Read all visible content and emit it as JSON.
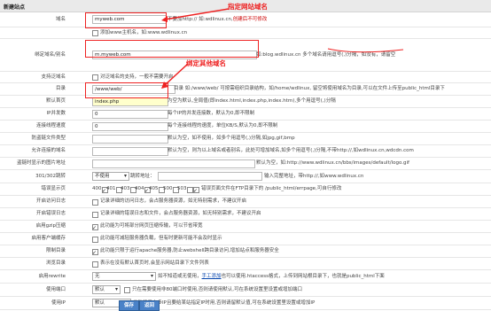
{
  "header": {
    "title": "新建站点"
  },
  "form": {
    "domain": {
      "label": "域名",
      "value": "myweb.com",
      "hint": "不要加http:// 如:wdlinux.cn,",
      "hint_red": "创建后不可修改"
    },
    "add_www": {
      "label": "添加www主机名，如:www.wdlinux.cn",
      "checked": false
    },
    "alias": {
      "label": "绑定域名/别名",
      "value": "m.myweb.com",
      "hint": "如:blog.wdlinux.cn 多个域名请用逗号(,)分隔，如没有，请留空"
    },
    "pan_domain": {
      "label": "支持泛域名",
      "text": "对泛域名的支持，一般不需要开启"
    },
    "dir": {
      "label": "目录",
      "value": "/www/web/",
      "hint": "目录 如:/www/web/ 可按需组织目录结构，如/home/wdlinux, 留空将使用域名为目录,可以在文件上传至public_html目录下"
    },
    "default_page": {
      "label": "默认首页",
      "value": "index.php",
      "hint": "为空为默认,全局值(即index.html,index.php,index.htm),多个用逗号(,)分隔"
    },
    "ip_conn": {
      "label": "IP并发数",
      "value": "0",
      "hint": "每个IP的并发连接数，默认为0,即不限制"
    },
    "conn_speed": {
      "label": "连接线程速度",
      "value": "0",
      "hint": "每个连接线程的速度，单位KB/S,默认为0,即不限制"
    },
    "hotlink_types": {
      "label": "防盗链文件类型",
      "value": "",
      "hint": "默认为空，如不使用，如多个用逗号(,)分隔,如jpg,gif,bmp"
    },
    "allow_domains": {
      "label": "允许连接的域名",
      "value": "",
      "hint": "默认为空，则为以上域名或者别名，此处可增加域名,如多个用逗号(,)分隔,不带http://,如wdlinux.cn,wdcdn.com"
    },
    "hotlink_image": {
      "label": "盗链时显示的图片地址",
      "value": "",
      "hint": "默认为空，如:http://www.wdlinux.cn/bbs/images/default/logo.gif"
    },
    "redirect": {
      "label": "301/302跳转",
      "select": "不使用",
      "addr_label": "跳转地址：",
      "addr_value": "",
      "hint": "输入完整地址，带http://,如www.wdlinux.cn"
    },
    "error_page": {
      "label": "错误显示页",
      "codes": [
        "400",
        "401",
        "403",
        "404",
        "405",
        "500",
        "503"
      ],
      "checked": [
        true,
        false,
        false,
        true,
        false,
        false,
        false
      ],
      "enable_label": "错误页面文件在FTP目录下的 /public_html/errpage,可自行修改"
    },
    "access_log": {
      "label": "开启访问日志",
      "text": "记录详细的访问日志，会占服务器资源，如无特别需求，不建议开启"
    },
    "error_log": {
      "label": "开启错误日志",
      "text": "记录详细的错误日志和文件，会占服务器资源，如无特别需求，不建议开启"
    },
    "gzip": {
      "label": "启用gzip压缩",
      "text": "此功能为可将部分网页压缩传输，可以节省带宽"
    },
    "server_cache": {
      "label": "启用客户端缓存",
      "text": "此功能可减轻服务器负载，但有时更新可能不会及时显示"
    },
    "limit_dir": {
      "label": "限制目录",
      "text": "此功能只限于运行apache服务器,防止webshell跨目录访问,增加站点和服务器安全"
    },
    "dir_browse": {
      "label": "浏览目录",
      "text": "表示在没有默认首页时,会显示网站目录下文件列表"
    },
    "rewrite": {
      "label": "启用rewrite",
      "select": "无",
      "hint1": "如不知道或无使用，",
      "link": "手工添加",
      "hint2": "也可以使用.htaccess格式，上传到网站根目录下，也就是public_html下面"
    },
    "port": {
      "label": "使用端口",
      "select": "默认",
      "hint": "只在需要使用非80端口时使用,否则请使用默认,可在系统设置里设置或增加端口"
    },
    "bind_ip": {
      "label": "使用IP",
      "select": "默认",
      "hint": "此功能只在多IP且要给某站指定IP时用,否则请留默认值,可在系统设置里设置或增加IP"
    }
  },
  "annotations": {
    "domain_note": "指定网站域名",
    "alias_note": "绑定其他域名"
  },
  "buttons": {
    "save": "保存",
    "back": "返回"
  },
  "colors": {
    "annotation": "#e22222",
    "button": "#4a82c8",
    "header_bg": "#eaeaea"
  }
}
